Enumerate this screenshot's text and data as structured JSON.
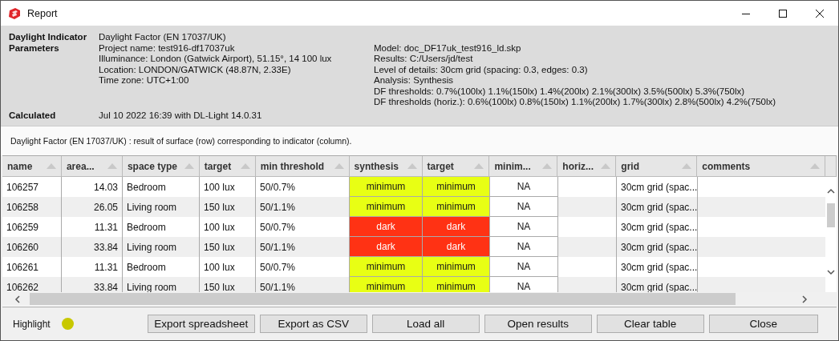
{
  "window": {
    "title": "Report"
  },
  "info": {
    "left": [
      {
        "label": "Daylight Indicator",
        "lines": [
          "Daylight Factor (EN 17037/UK)"
        ]
      },
      {
        "label": "Parameters",
        "lines": [
          "Project name: test916-df17037uk",
          "Illuminance: London (Gatwick Airport), 51.15°, 14 100 lux",
          "Location: LONDON/GATWICK (48.87N, 2.33E)",
          "Time zone: UTC+1:00"
        ]
      }
    ],
    "right": [
      "Model: doc_DF17uk_test916_ld.skp",
      "Results: C:/Users/jd/test",
      "Level of details: 30cm grid (spacing: 0.3, edges: 0.3)",
      "Analysis: Synthesis",
      "DF thresholds: 0.7%(100lx) 1.1%(150lx) 1.4%(200lx) 2.1%(300lx) 3.5%(500lx) 5.3%(750lx)",
      "DF thresholds (horiz.): 0.6%(100lx) 0.8%(150lx) 1.1%(200lx) 1.7%(300lx) 2.8%(500lx) 4.2%(750lx)"
    ],
    "calculated": {
      "label": "Calculated",
      "value": "Jul 10 2022 16:39 with DL-Light 14.0.31"
    }
  },
  "description": "Daylight Factor (EN 17037/UK) : result of surface (row) corresponding to indicator (column).",
  "table": {
    "columns": [
      "name",
      "area...",
      "space type",
      "target",
      "min threshold",
      "synthesis",
      "target",
      "minim...",
      "horiz...",
      "grid",
      "comments"
    ],
    "rows": [
      {
        "name": "106257",
        "area": "14.03",
        "space_type": "Bedroom",
        "target": "100 lux",
        "min_threshold": "50/0.7%",
        "synthesis": {
          "text": "minimum",
          "color": "#e8ff14"
        },
        "target_result": {
          "text": "minimum",
          "color": "#e8ff14"
        },
        "minimum": "NA",
        "grid": "30cm grid (spac..."
      },
      {
        "name": "106258",
        "area": "26.05",
        "space_type": "Living room",
        "target": "150 lux",
        "min_threshold": "50/1.1%",
        "synthesis": {
          "text": "minimum",
          "color": "#e8ff14"
        },
        "target_result": {
          "text": "minimum",
          "color": "#e8ff14"
        },
        "minimum": "NA",
        "grid": "30cm grid (spac..."
      },
      {
        "name": "106259",
        "area": "11.31",
        "space_type": "Bedroom",
        "target": "100 lux",
        "min_threshold": "50/0.7%",
        "synthesis": {
          "text": "dark",
          "color": "#ff3214"
        },
        "target_result": {
          "text": "dark",
          "color": "#ff3214"
        },
        "minimum": "NA",
        "grid": "30cm grid (spac..."
      },
      {
        "name": "106260",
        "area": "33.84",
        "space_type": "Living room",
        "target": "150 lux",
        "min_threshold": "50/1.1%",
        "synthesis": {
          "text": "dark",
          "color": "#ff3214"
        },
        "target_result": {
          "text": "dark",
          "color": "#ff3214"
        },
        "minimum": "NA",
        "grid": "30cm grid (spac..."
      },
      {
        "name": "106261",
        "area": "11.31",
        "space_type": "Bedroom",
        "target": "100 lux",
        "min_threshold": "50/0.7%",
        "synthesis": {
          "text": "minimum",
          "color": "#e8ff14"
        },
        "target_result": {
          "text": "minimum",
          "color": "#e8ff14"
        },
        "minimum": "NA",
        "grid": "30cm grid (spac..."
      },
      {
        "name": "106262",
        "area": "33.84",
        "space_type": "Living room",
        "target": "150 lux",
        "min_threshold": "50/1.1%",
        "synthesis": {
          "text": "minimum",
          "color": "#e8ff14"
        },
        "target_result": {
          "text": "minimum",
          "color": "#e8ff14"
        },
        "minimum": "NA",
        "grid": "30cm grid (spac..."
      }
    ]
  },
  "footer": {
    "highlight": {
      "label": "Highlight",
      "color": "#c8c800"
    },
    "buttons": [
      "Export spreadsheet",
      "Export as CSV",
      "Load all",
      "Open results",
      "Clear table",
      "Close"
    ]
  }
}
